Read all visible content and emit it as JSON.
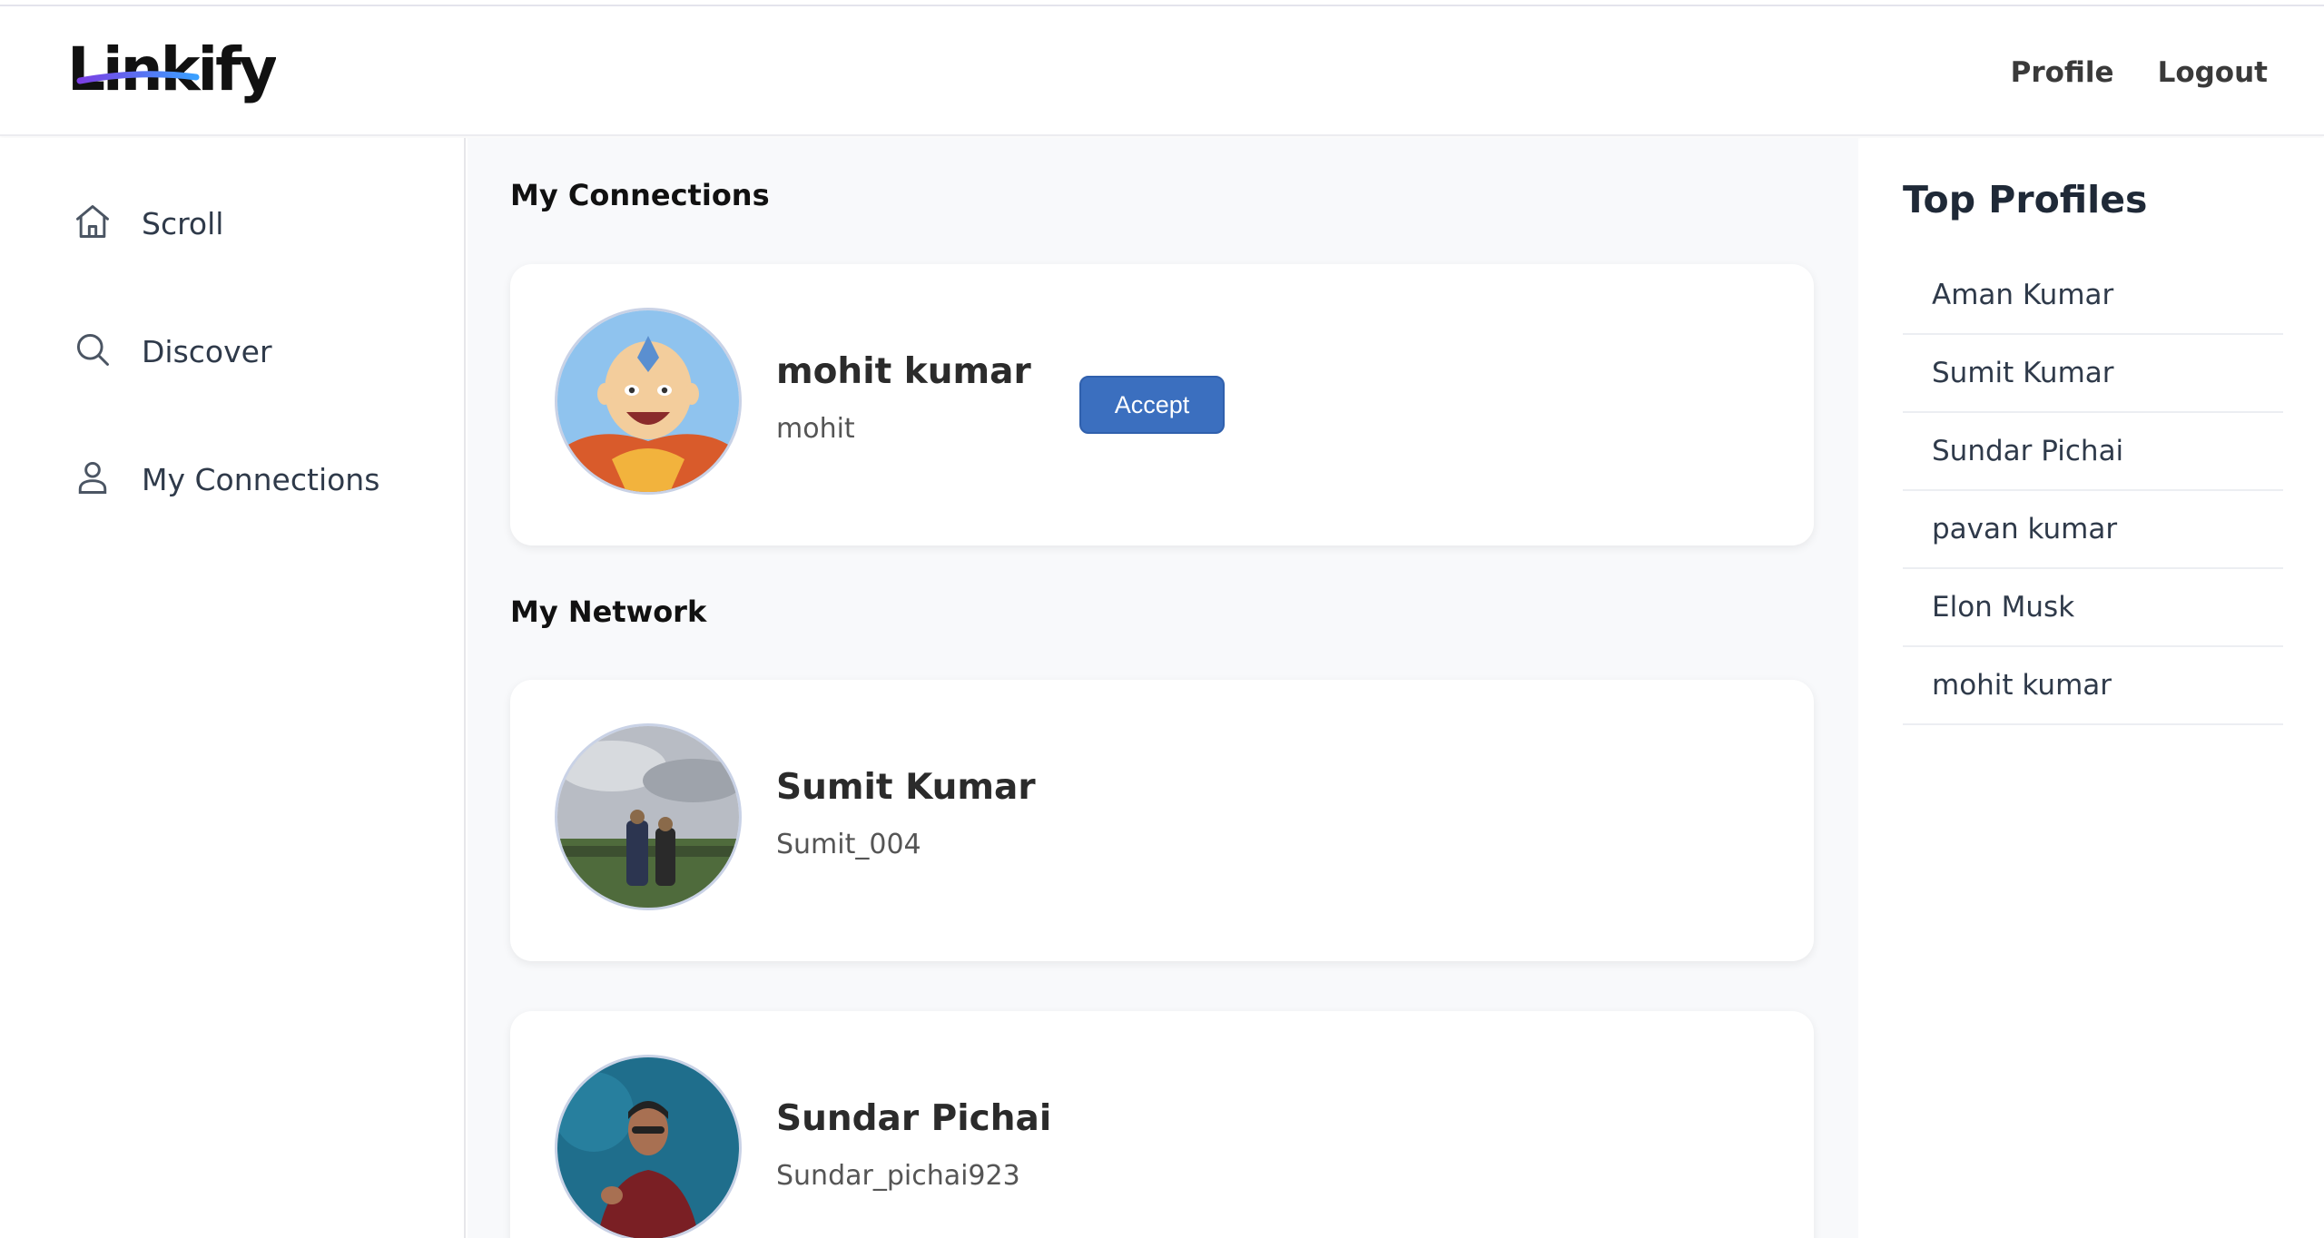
{
  "header": {
    "logo_text": "Linkify",
    "nav": [
      {
        "label": "Profile"
      },
      {
        "label": "Logout"
      }
    ]
  },
  "sidebar": {
    "items": [
      {
        "label": "Scroll",
        "icon": "home-icon"
      },
      {
        "label": "Discover",
        "icon": "search-icon"
      },
      {
        "label": "My Connections",
        "icon": "user-icon"
      }
    ]
  },
  "main": {
    "connections_title": "My Connections",
    "connections": [
      {
        "name": "mohit kumar",
        "username": "mohit",
        "action_label": "Accept",
        "avatar": "cartoon-avatar"
      }
    ],
    "network_title": "My Network",
    "network": [
      {
        "name": "Sumit Kumar",
        "username": "Sumit_004",
        "avatar": "outdoor-photo-avatar"
      },
      {
        "name": "Sundar Pichai",
        "username": "Sundar_pichai923",
        "avatar": "speaker-photo-avatar"
      }
    ]
  },
  "top_profiles": {
    "title": "Top Profiles",
    "items": [
      "Aman Kumar",
      "Sumit Kumar",
      "Sundar Pichai",
      "pavan kumar",
      "Elon Musk",
      "mohit kumar"
    ]
  },
  "colors": {
    "accent": "#3b6fbf",
    "logo_gradient_start": "#7b3fe4",
    "logo_gradient_end": "#3aa0ff"
  }
}
